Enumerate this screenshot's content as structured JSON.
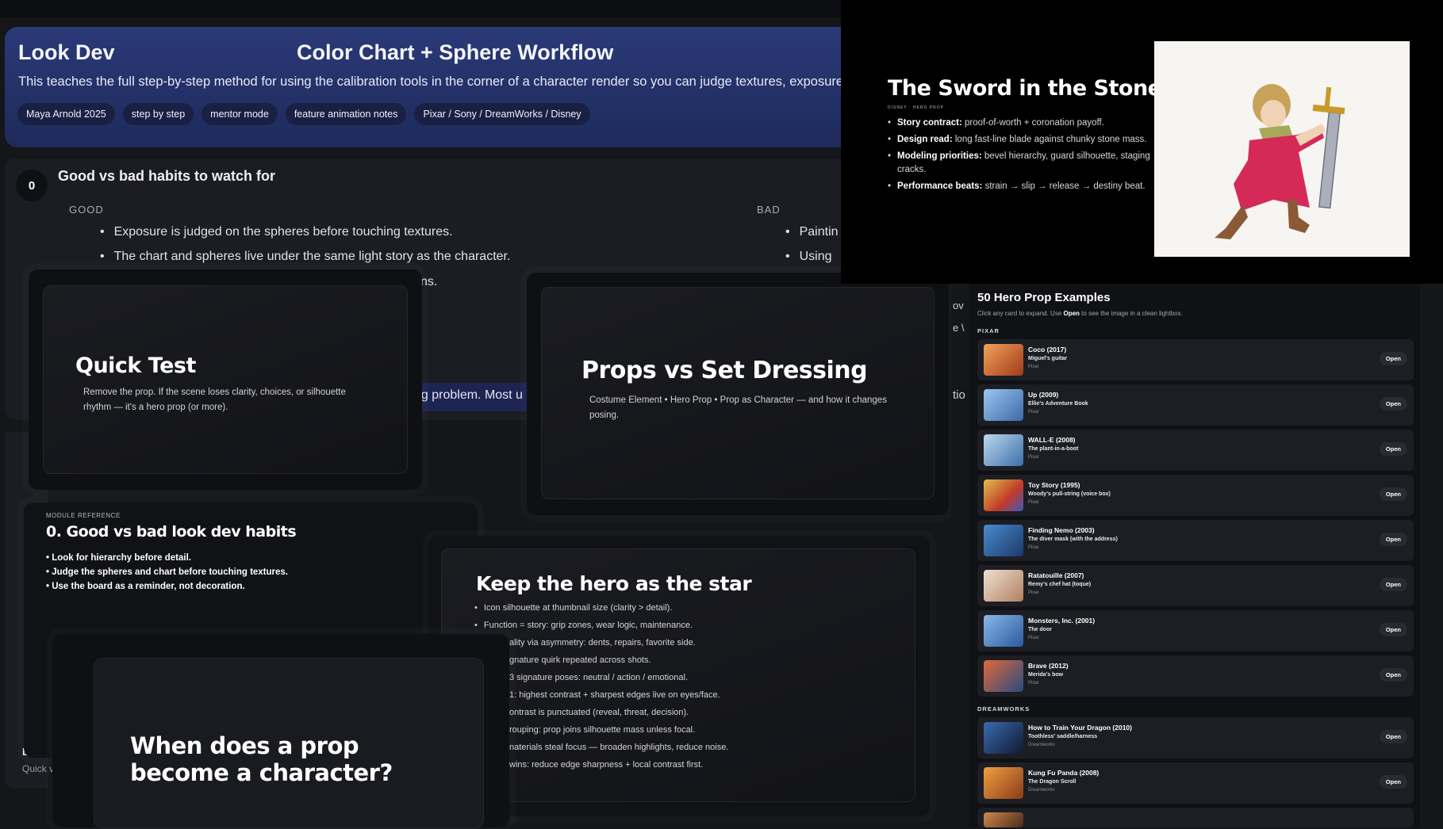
{
  "lesson": {
    "title": "Look Dev",
    "subtitle": "Color Chart + Sphere Workflow",
    "description": "This teaches the full step-by-step method for using the calibration tools in the corner of a character render so you can judge textures, exposure, rou",
    "chips": [
      "Maya Arnold 2025",
      "step by step",
      "mentor mode",
      "feature animation notes",
      "Pixar / Sony / DreamWorks / Disney"
    ],
    "section_number": "0",
    "section_title": "Good vs bad habits to watch for",
    "good_label": "GOOD",
    "bad_label": "BAD",
    "good_items": [
      "Exposure is judged on the spheres before touching textures.",
      "The chart and spheres live under the same light story as the character."
    ],
    "bad_items": [
      "Paintin",
      "Using"
    ],
    "partial_text_ns": "ns.",
    "partial_text_problem": "ng problem. Most u",
    "re_label": "RE",
    "lesson_label": "Lesso",
    "quick_label": "Quick v"
  },
  "slides": {
    "quick_test": {
      "title": "Quick Test",
      "body": "Remove the prop. If the scene loses clarity, choices, or silhouette rhythm — it's a hero prop (or more)."
    },
    "props_vs_set": {
      "title": "Props vs Set Dressing",
      "body": "Costume Element • Hero Prop • Prop as Character — and how it changes posing."
    },
    "module_ref": {
      "kicker": "MODULE REFERENCE",
      "title": "0. Good vs bad look dev habits",
      "items": [
        "• Look for hierarchy before detail.",
        "• Judge the spheres and chart before touching textures.",
        "• Use the board as a reminder, not decoration."
      ]
    },
    "keep_hero": {
      "title": "Keep the hero as the star",
      "items": [
        "Icon silhouette at thumbnail size (clarity > detail).",
        "Function = story: grip zones, wear logic, maintenance.",
        "ality via asymmetry: dents, repairs, favorite side.",
        "gnature quirk repeated across shots.",
        "3 signature poses: neutral / action / emotional.",
        "1: highest contrast + sharpest edges live on eyes/face.",
        "ontrast is punctuated (reveal, threat, decision).",
        "rouping: prop joins silhouette mass unless focal.",
        "naterials steal focus — broaden highlights, reduce noise.",
        "wins: reduce edge sharpness + local contrast first."
      ]
    },
    "when_prop": {
      "title": "When does a prop become a character?"
    }
  },
  "sword_slide": {
    "title": "The Sword in the Stone",
    "tag": "DISNEY · HERO PROP",
    "bullets": [
      {
        "label": "Story contract:",
        "text": " proof-of-worth + coronation payoff."
      },
      {
        "label": "Design read:",
        "text": " long fast-line blade against chunky stone mass."
      },
      {
        "label": "Modeling priorities:",
        "text": " bevel hierarchy, guard silhouette, staging cracks."
      },
      {
        "label": "Performance beats:",
        "text": " strain → slip → release → destiny beat."
      }
    ]
  },
  "examples": {
    "title": "50 Hero Prop Examples",
    "hint_pre": "Click any card to expand. Use ",
    "hint_bold": "Open",
    "hint_post": " to see the image in a clean lightbox.",
    "groups": [
      {
        "name": "PIXAR",
        "cards": [
          {
            "title": "Coco (2017)",
            "sub": "Miguel's guitar",
            "studio": "Pixar",
            "color": "#c0512b"
          },
          {
            "title": "Up (2009)",
            "sub": "Ellie's Adventure Book",
            "studio": "Pixar",
            "color": "#5a86c4"
          },
          {
            "title": "WALL-E (2008)",
            "sub": "The plant-in-a-boot",
            "studio": "Pixar",
            "color": "#6a9ccf"
          },
          {
            "title": "Toy Story (1995)",
            "sub": "Woody's pull-string (voice box)",
            "studio": "Pixar",
            "color": "#c24a3a"
          },
          {
            "title": "Finding Nemo (2003)",
            "sub": "The diver mask (with the address)",
            "studio": "Pixar",
            "color": "#2f5f9a"
          },
          {
            "title": "Ratatouille (2007)",
            "sub": "Remy's chef hat (toque)",
            "studio": "Pixar",
            "color": "#c9a07a"
          },
          {
            "title": "Monsters, Inc. (2001)",
            "sub": "The door",
            "studio": "Pixar",
            "color": "#4c78b8"
          },
          {
            "title": "Brave (2012)",
            "sub": "Merida's bow",
            "studio": "Pixar",
            "color": "#3d5f92"
          }
        ]
      },
      {
        "name": "DREAMWORKS",
        "cards": [
          {
            "title": "How to Train Your Dragon (2010)",
            "sub": "Toothless' saddle/harness",
            "studio": "Dreamworks",
            "color": "#2b4f86"
          },
          {
            "title": "Kung Fu Panda (2008)",
            "sub": "The Dragon Scroll",
            "studio": "Dreamworks",
            "color": "#d06a2a"
          }
        ]
      }
    ],
    "open_label": "Open"
  }
}
